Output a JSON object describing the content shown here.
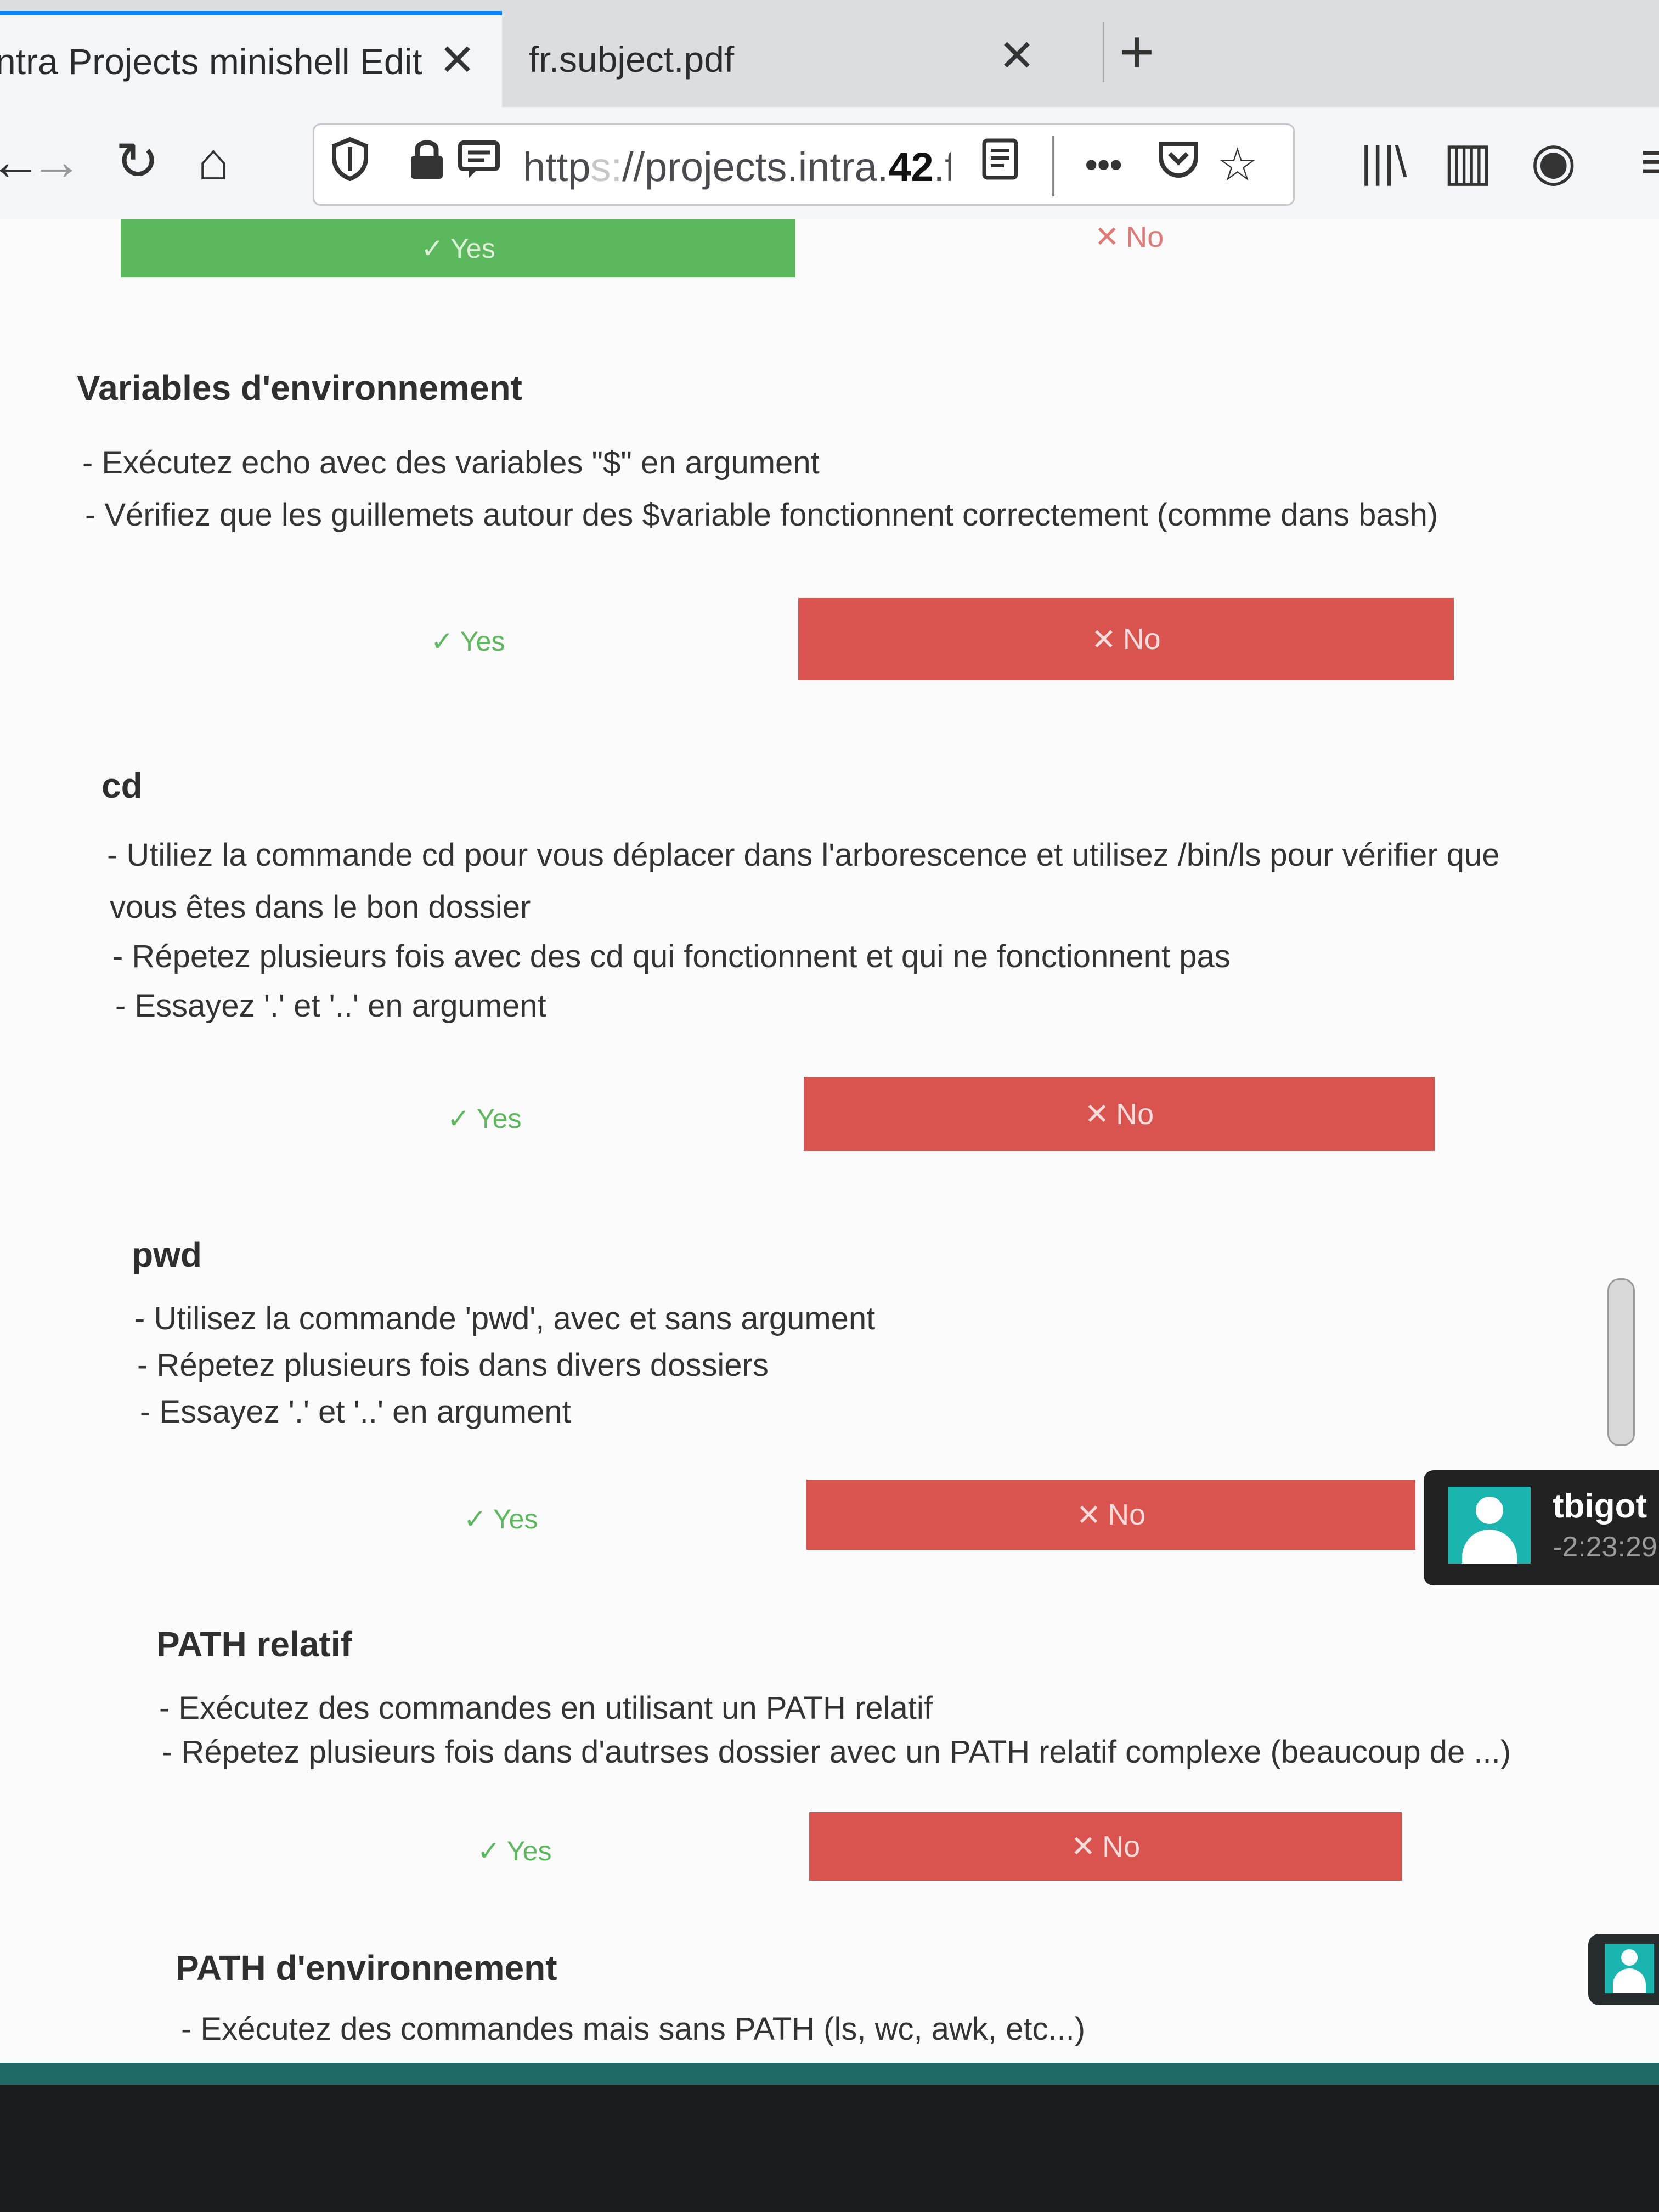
{
  "browser": {
    "tabs": [
      {
        "title": "ntra Projects minishell Edit",
        "close": "✕"
      },
      {
        "title": "fr.subject.pdf",
        "close": "✕"
      }
    ],
    "new_tab": "+",
    "nav": {
      "back": "←",
      "forward": "→",
      "reload": "↻",
      "home": "⌂"
    },
    "url": {
      "prefix": "http",
      "masked": "s:",
      "rest": "//projects.intra.",
      "bold": "42",
      "tail": ".fr/sc"
    },
    "toolbar": {
      "more": "•••",
      "pocket": "◡",
      "star": "☆",
      "library": "|||\\",
      "sidebar": "▥",
      "account": "◉",
      "menu": "≡"
    }
  },
  "top_partial": {
    "yes_label": "Yes",
    "no_label": "No"
  },
  "sections": [
    {
      "title": "Variables d'environnement",
      "lines": [
        "- Exécutez echo avec des variables \"$\" en argument",
        "- Vérifiez que les guillemets autour des $variable fonctionnent correctement (comme dans bash)"
      ],
      "yes_label": "Yes",
      "no_label": "No"
    },
    {
      "title": "cd",
      "lines": [
        "- Utiliez la commande cd pour vous déplacer dans l'arborescence et utilisez /bin/ls pour vérifier que",
        "vous êtes dans le bon dossier",
        "- Répetez plusieurs fois avec des cd qui fonctionnent et qui ne fonctionnent pas",
        "- Essayez '.' et '..' en argument"
      ],
      "yes_label": "Yes",
      "no_label": "No"
    },
    {
      "title": "pwd",
      "lines": [
        "- Utilisez la commande 'pwd', avec et sans argument",
        "- Répetez plusieurs fois dans divers dossiers",
        "- Essayez '.' et '..' en argument"
      ],
      "yes_label": "Yes",
      "no_label": "No"
    },
    {
      "title": "PATH relatif",
      "lines": [
        "- Exécutez des commandes en utilisant un PATH relatif",
        "- Répetez plusieurs fois dans d'autrses dossier avec un PATH relatif complexe (beaucoup de ...)"
      ],
      "yes_label": "Yes",
      "no_label": "No"
    },
    {
      "title": "PATH d'environnement",
      "lines": [
        "- Exécutez des commandes mais sans PATH (ls, wc, awk, etc...)"
      ]
    }
  ],
  "chat": {
    "name": "tbigot",
    "time": "-2:23:29"
  },
  "icons": {
    "check": "✓",
    "cross": "✕"
  },
  "colors": {
    "yes_green": "#5cb85c",
    "no_red": "#d9534f",
    "tab_accent": "#0a84ff",
    "avatar_teal": "#1bb5b0"
  }
}
